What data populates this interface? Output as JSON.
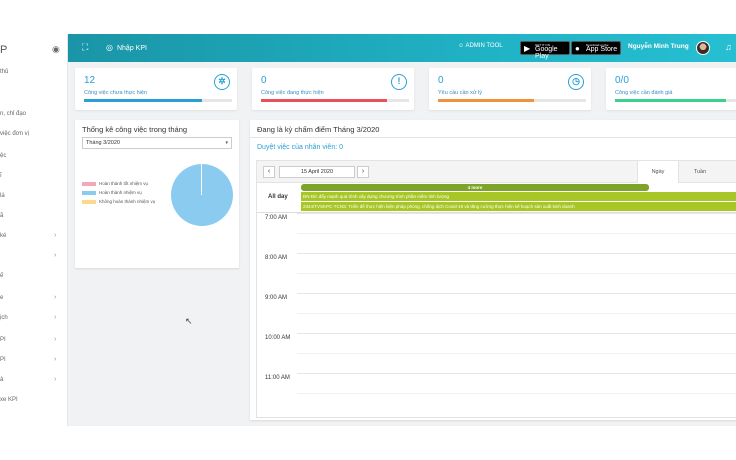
{
  "sidebar": {
    "logo_fragment": "P",
    "items": [
      {
        "label": "thủ",
        "chevron": false
      },
      {
        "label": "n, chỉ đạo",
        "chevron": false
      },
      {
        "label": "việc đơn vị",
        "chevron": false
      },
      {
        "label": "ệc",
        "chevron": false
      },
      {
        "label": "ĩ",
        "chevron": false
      },
      {
        "label": "lá",
        "chevron": false
      },
      {
        "label": "ã",
        "chevron": false
      },
      {
        "label": "ké",
        "chevron": true
      },
      {
        "label": "",
        "chevron": true
      },
      {
        "label": "ế",
        "chevron": false
      },
      {
        "label": "e",
        "chevron": true
      },
      {
        "label": "ịch",
        "chevron": true
      },
      {
        "label": "PI",
        "chevron": true
      },
      {
        "label": "PI",
        "chevron": true
      },
      {
        "label": "ả",
        "chevron": true
      },
      {
        "label": "xe KPI",
        "chevron": false
      }
    ]
  },
  "topbar": {
    "kpi_label": "Nhập KPI",
    "admin_tool": "ADMIN TOOL",
    "google_play_small": "GET IT ON",
    "google_play_big": "Google Play",
    "app_store_small": "Download on the",
    "app_store_big": "App Store",
    "username": "Nguyễn Minh Trung"
  },
  "stats": [
    {
      "value": "12",
      "label": "Công việc chưa thực hiện",
      "icon": "aperture-icon",
      "color": "#2a9fd6",
      "progress": 0.8
    },
    {
      "value": "0",
      "label": "Công việc đang thực hiện",
      "icon": "alert-icon",
      "color": "#e8505b",
      "progress": 0.85
    },
    {
      "value": "0",
      "label": "Yêu cầu cần xử lý",
      "icon": "clock-icon",
      "color": "#f0923b",
      "progress": 0.65
    },
    {
      "value": "0/0",
      "label": "Công việc cần đánh giá",
      "icon": "check-icon",
      "color": "#3ccf8e",
      "progress": 0.75
    }
  ],
  "task_stats": {
    "title": "Thống kê công việc trong tháng",
    "month": "Tháng 3/2020",
    "legend": [
      {
        "label": "Hoàn thành tốt nhiệm vụ",
        "color": "#f4a7b9"
      },
      {
        "label": "Hoàn thành nhiệm vụ",
        "color": "#8ccbf0"
      },
      {
        "label": "Không hoàn thành nhiệm vụ",
        "color": "#fbd98d"
      }
    ],
    "pie_color": "#8ccbf0"
  },
  "scoring": {
    "title": "Đang là kỳ chấm điểm Tháng 3/2020",
    "subtitle": "Duyệt việc của nhân viên: 0"
  },
  "calendar": {
    "date": "15 April 2020",
    "tabs": [
      "Ngày",
      "Tuần"
    ],
    "allday_label": "All day",
    "more_label": "4 more",
    "events": [
      "ĐN Đ/c đẩy mạnh quá trình xây dựng chương trình phần mềm tỉnh lượng",
      "2344/TVSKPC-TCNS: Triển để thực hiện biện pháp phòng, chống dịch Covid-19 và tăng cường thực hiện kế hoạch sản xuất kinh doanh"
    ],
    "times": [
      "7:00 AM",
      "8:00 AM",
      "9:00 AM",
      "10:00 AM",
      "11:00 AM"
    ]
  }
}
